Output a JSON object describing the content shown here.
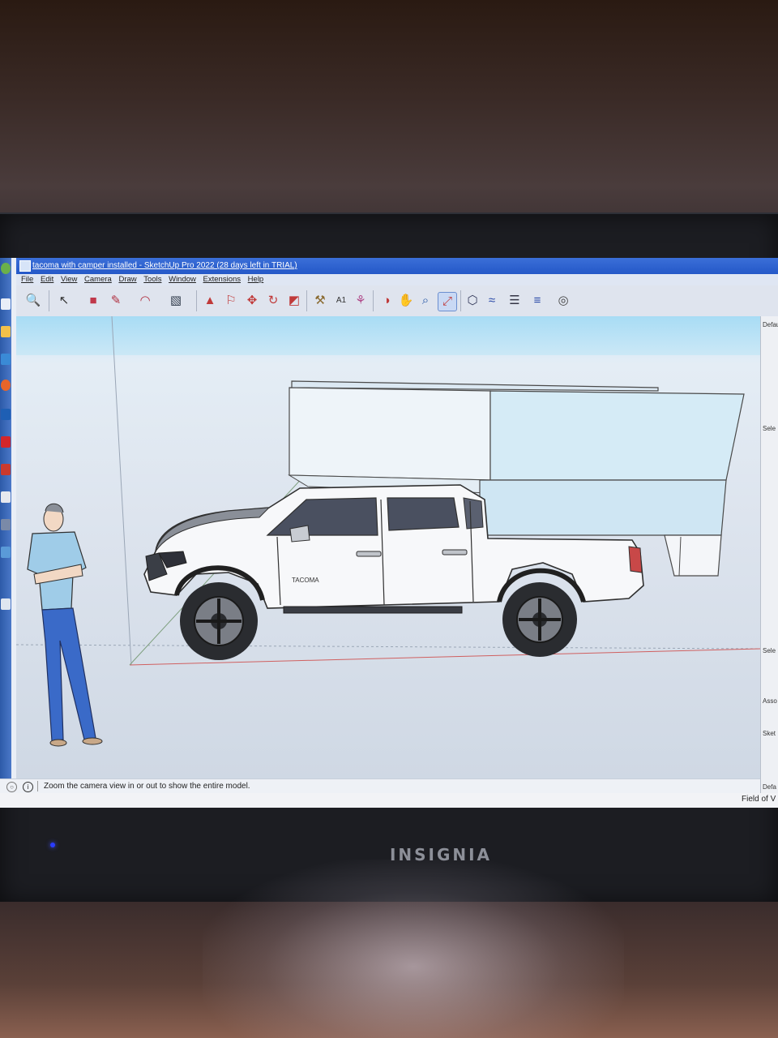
{
  "window": {
    "title": "tacoma with camper installed - SketchUp Pro 2022 (28 days left in TRIAL)"
  },
  "menu": [
    "File",
    "Edit",
    "View",
    "Camera",
    "Draw",
    "Tools",
    "Window",
    "Extensions",
    "Help"
  ],
  "toolbar": {
    "tools": [
      {
        "name": "search",
        "icon": "search-icon"
      },
      {
        "name": "select",
        "icon": "select-arrow-icon"
      },
      {
        "name": "eraser",
        "icon": "eraser-icon"
      },
      {
        "name": "pencil",
        "icon": "pencil-icon"
      },
      {
        "name": "arc",
        "icon": "arc-icon"
      },
      {
        "name": "rectangle",
        "icon": "rectangle-icon"
      },
      {
        "name": "push-pull",
        "icon": "push-pull-icon"
      },
      {
        "name": "offset",
        "icon": "offset-icon"
      },
      {
        "name": "move",
        "icon": "move-icon"
      },
      {
        "name": "rotate",
        "icon": "rotate-icon"
      },
      {
        "name": "scale",
        "icon": "scale-icon"
      },
      {
        "name": "tape-measure",
        "icon": "tape-measure-icon"
      },
      {
        "name": "text",
        "icon": "text-icon"
      },
      {
        "name": "paint-bucket",
        "icon": "paint-bucket-icon"
      },
      {
        "name": "orbit",
        "icon": "orbit-icon"
      },
      {
        "name": "pan",
        "icon": "pan-icon"
      },
      {
        "name": "zoom",
        "icon": "zoom-icon"
      },
      {
        "name": "zoom-extents",
        "icon": "zoom-extents-icon"
      },
      {
        "name": "3d-warehouse",
        "icon": "warehouse-icon"
      },
      {
        "name": "extension-warehouse",
        "icon": "extension-warehouse-icon"
      },
      {
        "name": "layout",
        "icon": "layout-icon"
      },
      {
        "name": "extension-manager",
        "icon": "extension-manager-icon"
      },
      {
        "name": "account",
        "icon": "account-icon"
      }
    ],
    "active_tool": "zoom-extents"
  },
  "status": {
    "message": "Zoom the camera view in or out to show the entire model.",
    "field_label": "Field of V"
  },
  "tray": [
    "Default",
    "Sele",
    "Sele",
    "Asso",
    "Sket",
    "Defa"
  ],
  "monitor": {
    "brand": "INSIGNIA"
  },
  "model": {
    "vehicle_badge": "TACOMA"
  }
}
